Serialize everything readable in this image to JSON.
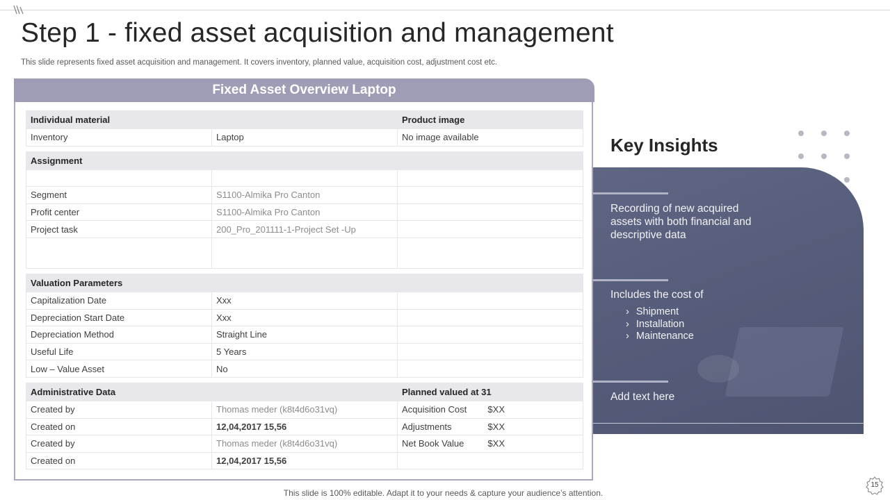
{
  "slide": {
    "title": "Step 1 - fixed asset acquisition and management",
    "subtitle": "This slide represents fixed asset acquisition and management. It covers inventory,  planned value, acquisition cost, adjustment cost etc.",
    "footer": "This slide is 100% editable. Adapt it to your needs & capture your audience’s attention.",
    "page_number": "15"
  },
  "panel": {
    "header": "Fixed Asset Overview Laptop",
    "sec1": {
      "col1": "Individual material",
      "col3": "Product image"
    },
    "inventory": {
      "label": "Inventory",
      "value": "Laptop",
      "image": "No image available"
    },
    "sec2": {
      "col1": "Assignment"
    },
    "segment": {
      "label": "Segment",
      "value": "S1100-Almika Pro Canton"
    },
    "profit_center": {
      "label": "Profit center",
      "value": "S1100-Almika Pro Canton"
    },
    "project_task": {
      "label": "Project task",
      "value": "200_Pro_201111-1-Project  Set -Up"
    },
    "sec3": {
      "col1": "Valuation Parameters"
    },
    "cap_date": {
      "label": "Capitalization Date",
      "value": "Xxx"
    },
    "dep_start": {
      "label": "Depreciation Start Date",
      "value": "Xxx"
    },
    "dep_method": {
      "label": "Depreciation Method",
      "value": "Straight Line"
    },
    "useful_life": {
      "label": "Useful Life",
      "value": "5 Years"
    },
    "low_value": {
      "label": "Low – Value Asset",
      "value": "No"
    },
    "sec4": {
      "col1": "Administrative Data",
      "col3": "Planned valued at 31"
    },
    "admin_rows": [
      {
        "label": "Created by",
        "value": "Thomas meder (k8t4d6o31vq)",
        "plan_label": "Acquisition Cost",
        "plan_value": "$XX"
      },
      {
        "label": "Created on",
        "value": "12,04,2017  15,56",
        "plan_label": "Adjustments",
        "plan_value": "$XX"
      },
      {
        "label": "Created by",
        "value": "Thomas meder (k8t4d6o31vq)",
        "plan_label": "Net Book Value",
        "plan_value": "$XX"
      },
      {
        "label": "Created on",
        "value": "12,04,2017  15,56"
      }
    ]
  },
  "insights": {
    "title": "Key Insights",
    "item1": "Recording of new acquired assets with both financial and descriptive data",
    "item2": "Includes  the cost of",
    "item2_list": [
      "Shipment",
      "Installation",
      "Maintenance"
    ],
    "item3": "Add text here"
  }
}
